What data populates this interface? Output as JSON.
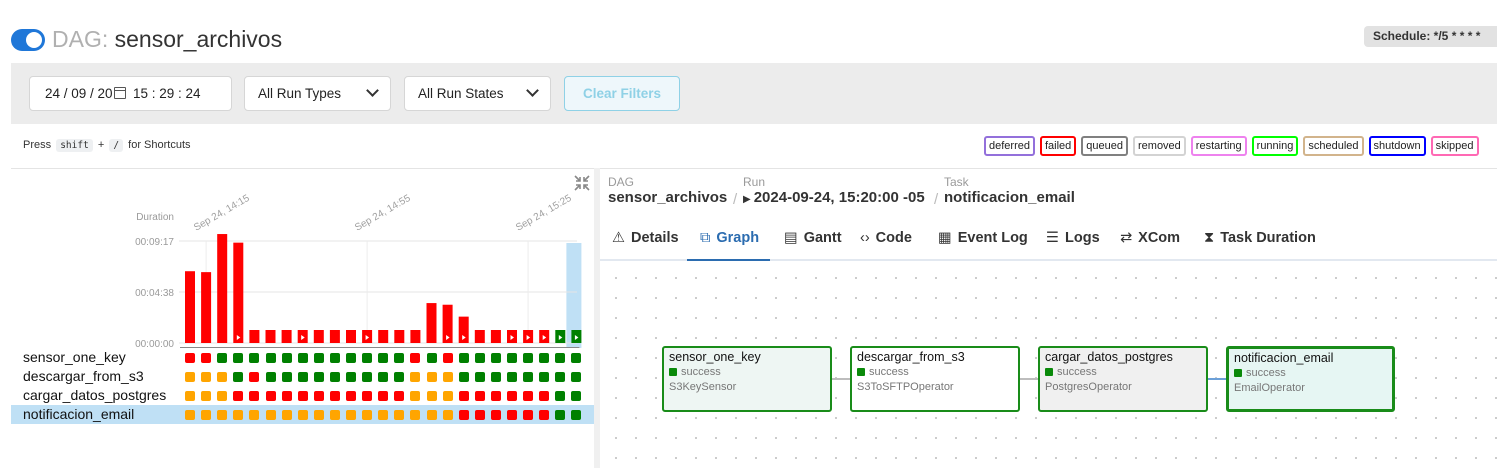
{
  "header": {
    "dag_prefix": "DAG:",
    "dag_name": "sensor_archivos",
    "schedule": "Schedule: */5 * * * *",
    "paused_toggle_on": true,
    "accent": "#1f77d8"
  },
  "filters": {
    "date": "24 / 09 / 20",
    "time": "15 : 29 : 24",
    "run_types": "All Run Types",
    "run_states": "All Run States",
    "clear": "Clear Filters"
  },
  "shortcuts": {
    "press": "Press",
    "key1": "shift",
    "plus": "+",
    "key2": "/",
    "suffix": "for Shortcuts"
  },
  "legend": [
    {
      "label": "deferred",
      "color": "#9370db"
    },
    {
      "label": "failed",
      "color": "#ff0000"
    },
    {
      "label": "queued",
      "color": "#808080"
    },
    {
      "label": "removed",
      "color": "#d3d3d3"
    },
    {
      "label": "restarting",
      "color": "#ee82ee"
    },
    {
      "label": "running",
      "color": "#00ff00"
    },
    {
      "label": "scheduled",
      "color": "#d2b48c"
    },
    {
      "label": "shutdown",
      "color": "#0000ff"
    },
    {
      "label": "skipped",
      "color": "#ff69b4"
    }
  ],
  "chart_data": {
    "type": "bar",
    "ylabel": "Duration",
    "y_ticks": [
      "00:09:17",
      "00:04:38",
      "00:00:00"
    ],
    "ylim_seconds": [
      0,
      557
    ],
    "x_tick_labels": [
      "Sep 24, 14:15",
      "Sep 24, 14:55",
      "Sep 24, 15:25"
    ],
    "x_tick_positions": [
      1,
      11,
      21
    ],
    "values_seconds": [
      392,
      387,
      595,
      548,
      0,
      0,
      0,
      0,
      0,
      0,
      0,
      0,
      0,
      0,
      0,
      218,
      209,
      144,
      0,
      0,
      0,
      0,
      0,
      0,
      0
    ],
    "has_running_icon": [
      false,
      false,
      false,
      true,
      false,
      false,
      false,
      true,
      false,
      false,
      false,
      true,
      false,
      false,
      false,
      false,
      true,
      true,
      false,
      false,
      true,
      true,
      true,
      true,
      true
    ],
    "bar_colors": [
      "#ff0000",
      "#ff0000",
      "#ff0000",
      "#ff0000",
      "#ff0000",
      "#ff0000",
      "#ff0000",
      "#ff0000",
      "#ff0000",
      "#ff0000",
      "#ff0000",
      "#ff0000",
      "#ff0000",
      "#ff0000",
      "#ff0000",
      "#ff0000",
      "#ff0000",
      "#ff0000",
      "#ff0000",
      "#ff0000",
      "#ff0000",
      "#ff0000",
      "#ff0000",
      "#008000",
      "#008000"
    ],
    "selected_index": 24
  },
  "grid": {
    "tasks": [
      {
        "name": "sensor_one_key",
        "states": [
          "r",
          "r",
          "g",
          "g",
          "g",
          "g",
          "g",
          "g",
          "g",
          "g",
          "g",
          "g",
          "g",
          "g",
          "r",
          "g",
          "r",
          "g",
          "g",
          "g",
          "g",
          "g",
          "g",
          "g",
          "g"
        ]
      },
      {
        "name": "descargar_from_s3",
        "states": [
          "o",
          "o",
          "o",
          "g",
          "r",
          "g",
          "g",
          "g",
          "g",
          "g",
          "g",
          "g",
          "g",
          "g",
          "o",
          "o",
          "o",
          "g",
          "g",
          "g",
          "g",
          "g",
          "g",
          "g",
          "g"
        ]
      },
      {
        "name": "cargar_datos_postgres",
        "states": [
          "o",
          "o",
          "o",
          "r",
          "r",
          "r",
          "r",
          "r",
          "r",
          "r",
          "r",
          "r",
          "r",
          "r",
          "o",
          "o",
          "o",
          "r",
          "r",
          "r",
          "r",
          "r",
          "r",
          "g",
          "g"
        ]
      },
      {
        "name": "notificacion_email",
        "states": [
          "o",
          "o",
          "o",
          "o",
          "o",
          "o",
          "o",
          "o",
          "o",
          "o",
          "o",
          "o",
          "o",
          "o",
          "o",
          "o",
          "o",
          "r",
          "r",
          "r",
          "r",
          "r",
          "r",
          "g",
          "g"
        ]
      }
    ],
    "selected_task": 3,
    "colors": {
      "g": "#008000",
      "r": "#ff0000",
      "o": "#ffa500"
    }
  },
  "breadcrumb": {
    "dag_label": "DAG",
    "dag_value": "sensor_archivos",
    "run_label": "Run",
    "run_value": "2024-09-24, 15:20:00 -05",
    "task_label": "Task",
    "task_value": "notificacion_email"
  },
  "tabs": [
    {
      "label": "Details",
      "icon": "warning-icon",
      "glyph": "⚠"
    },
    {
      "label": "Graph",
      "icon": "graph-icon",
      "glyph": "⧉",
      "active": true
    },
    {
      "label": "Gantt",
      "icon": "gantt-icon",
      "glyph": "▤"
    },
    {
      "label": "Code",
      "icon": "code-icon",
      "glyph": "‹›"
    },
    {
      "label": "Event Log",
      "icon": "event-log-icon",
      "glyph": "▦"
    },
    {
      "label": "Logs",
      "icon": "logs-icon",
      "glyph": "☰"
    },
    {
      "label": "XCom",
      "icon": "xcom-icon",
      "glyph": "⇄"
    },
    {
      "label": "Task Duration",
      "icon": "hourglass-icon",
      "glyph": "⧗"
    }
  ],
  "graph_nodes": [
    {
      "name": "sensor_one_key",
      "state": "success",
      "operator": "S3KeySensor",
      "bg": "#eef6f3"
    },
    {
      "name": "descargar_from_s3",
      "state": "success",
      "operator": "S3ToSFTPOperator",
      "bg": "#ffffff"
    },
    {
      "name": "cargar_datos_postgres",
      "state": "success",
      "operator": "PostgresOperator",
      "bg": "#f0f0f0"
    },
    {
      "name": "notificacion_email",
      "state": "success",
      "operator": "EmailOperator",
      "bg": "#e6f6f3"
    }
  ]
}
